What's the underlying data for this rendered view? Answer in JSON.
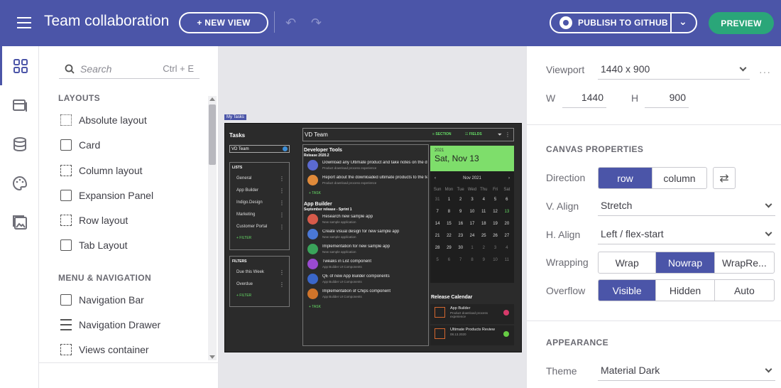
{
  "header": {
    "title": "Team collaboration",
    "new_view": "+ NEW VIEW",
    "publish": "PUBLISH TO GITHUB",
    "preview": "PREVIEW"
  },
  "search": {
    "placeholder": "Search",
    "shortcut": "Ctrl + E"
  },
  "sections": {
    "layouts": "LAYOUTS",
    "menu_nav": "MENU & NAVIGATION"
  },
  "layouts": [
    "Absolute layout",
    "Card",
    "Column layout",
    "Expansion Panel",
    "Row layout",
    "Tab Layout"
  ],
  "menu_nav": [
    "Navigation Bar",
    "Navigation Drawer",
    "Views container"
  ],
  "canvas": {
    "tag": "My Tasks",
    "tasks_title": "Tasks",
    "team_select": "VD Team",
    "lists_title": "LISTS",
    "lists": [
      "General",
      "App Builder",
      "Indigo.Design",
      "Marketing",
      "Customer Portal"
    ],
    "filter": "+ FILTER",
    "filters_title": "FILTERS",
    "filters": [
      "Due this Week",
      "Overdue"
    ],
    "board_title": "VD Team",
    "section_btn": "SECTION",
    "fields_btn": "FIELDS",
    "task_btn": "+ TASK",
    "board_sections": [
      {
        "title": "Developer Tools",
        "sub": "Release 2020.2",
        "items": [
          {
            "t1": "Download any Ultimate product and take notes on the download process",
            "t2": "Product download process experience",
            "color": "#5b6ad0"
          },
          {
            "t1": "Report about the downloaded ultimate products to the team",
            "t2": "Product download process experience",
            "color": "#e08a3a"
          }
        ]
      },
      {
        "title": "App Builder",
        "sub": "September release - Sprint 1",
        "items": [
          {
            "t1": "Research new sample app",
            "t2": "New sample application",
            "color": "#d65a4a"
          },
          {
            "t1": "Create visual design for new sample app",
            "t2": "New sample application",
            "color": "#4a78d6"
          },
          {
            "t1": "Implementation for new sample app",
            "t2": "New sample application",
            "color": "#3aa35a"
          },
          {
            "t1": "Tweaks in List component",
            "t2": "App Builder UI Components",
            "color": "#9a4ad0"
          },
          {
            "t1": "QE of new App Builder components",
            "t2": "App Builder UI Components",
            "color": "#3a66c9"
          },
          {
            "t1": "Implementation of Chips component",
            "t2": "App Builder UI Components",
            "color": "#d0742a"
          }
        ]
      }
    ],
    "calendar": {
      "year": "2021",
      "date": "Sat, Nov 13",
      "month": "Nov 2021",
      "weekdays": [
        "Sun",
        "Mon",
        "Tue",
        "Wed",
        "Thu",
        "Fri",
        "Sat"
      ],
      "days": [
        "31",
        "1",
        "2",
        "3",
        "4",
        "5",
        "6",
        "7",
        "8",
        "9",
        "10",
        "11",
        "12",
        "13",
        "14",
        "15",
        "16",
        "17",
        "18",
        "19",
        "20",
        "21",
        "22",
        "23",
        "24",
        "25",
        "26",
        "27",
        "28",
        "29",
        "30",
        "1",
        "2",
        "3",
        "4",
        "5",
        "6",
        "7",
        "8",
        "9",
        "10",
        "11"
      ]
    },
    "release": {
      "title": "Release Calendar",
      "items": [
        {
          "t1": "App Builder",
          "t2": "Product download process experience",
          "badge": "#d63a6a"
        },
        {
          "t1": "Ultimate Products Review",
          "t2": "08.13.2020",
          "badge": "#66cc44"
        }
      ]
    }
  },
  "props": {
    "viewport_label": "Viewport",
    "viewport_value": "1440 x 900",
    "w_label": "W",
    "w_value": "1440",
    "h_label": "H",
    "h_value": "900",
    "canvas_title": "CANVAS PROPERTIES",
    "direction_label": "Direction",
    "direction": [
      "row",
      "column"
    ],
    "valign_label": "V. Align",
    "valign_value": "Stretch",
    "halign_label": "H. Align",
    "halign_value": "Left / flex-start",
    "wrapping_label": "Wrapping",
    "wrapping": [
      "Wrap",
      "Nowrap",
      "WrapRe..."
    ],
    "overflow_label": "Overflow",
    "overflow": [
      "Visible",
      "Hidden",
      "Auto"
    ],
    "appearance_title": "APPEARANCE",
    "theme_label": "Theme",
    "theme_value": "Material Dark"
  },
  "colors": {
    "brand": "#4b55a8",
    "preview": "#2aa679",
    "calendar_head": "#7ede6b"
  }
}
